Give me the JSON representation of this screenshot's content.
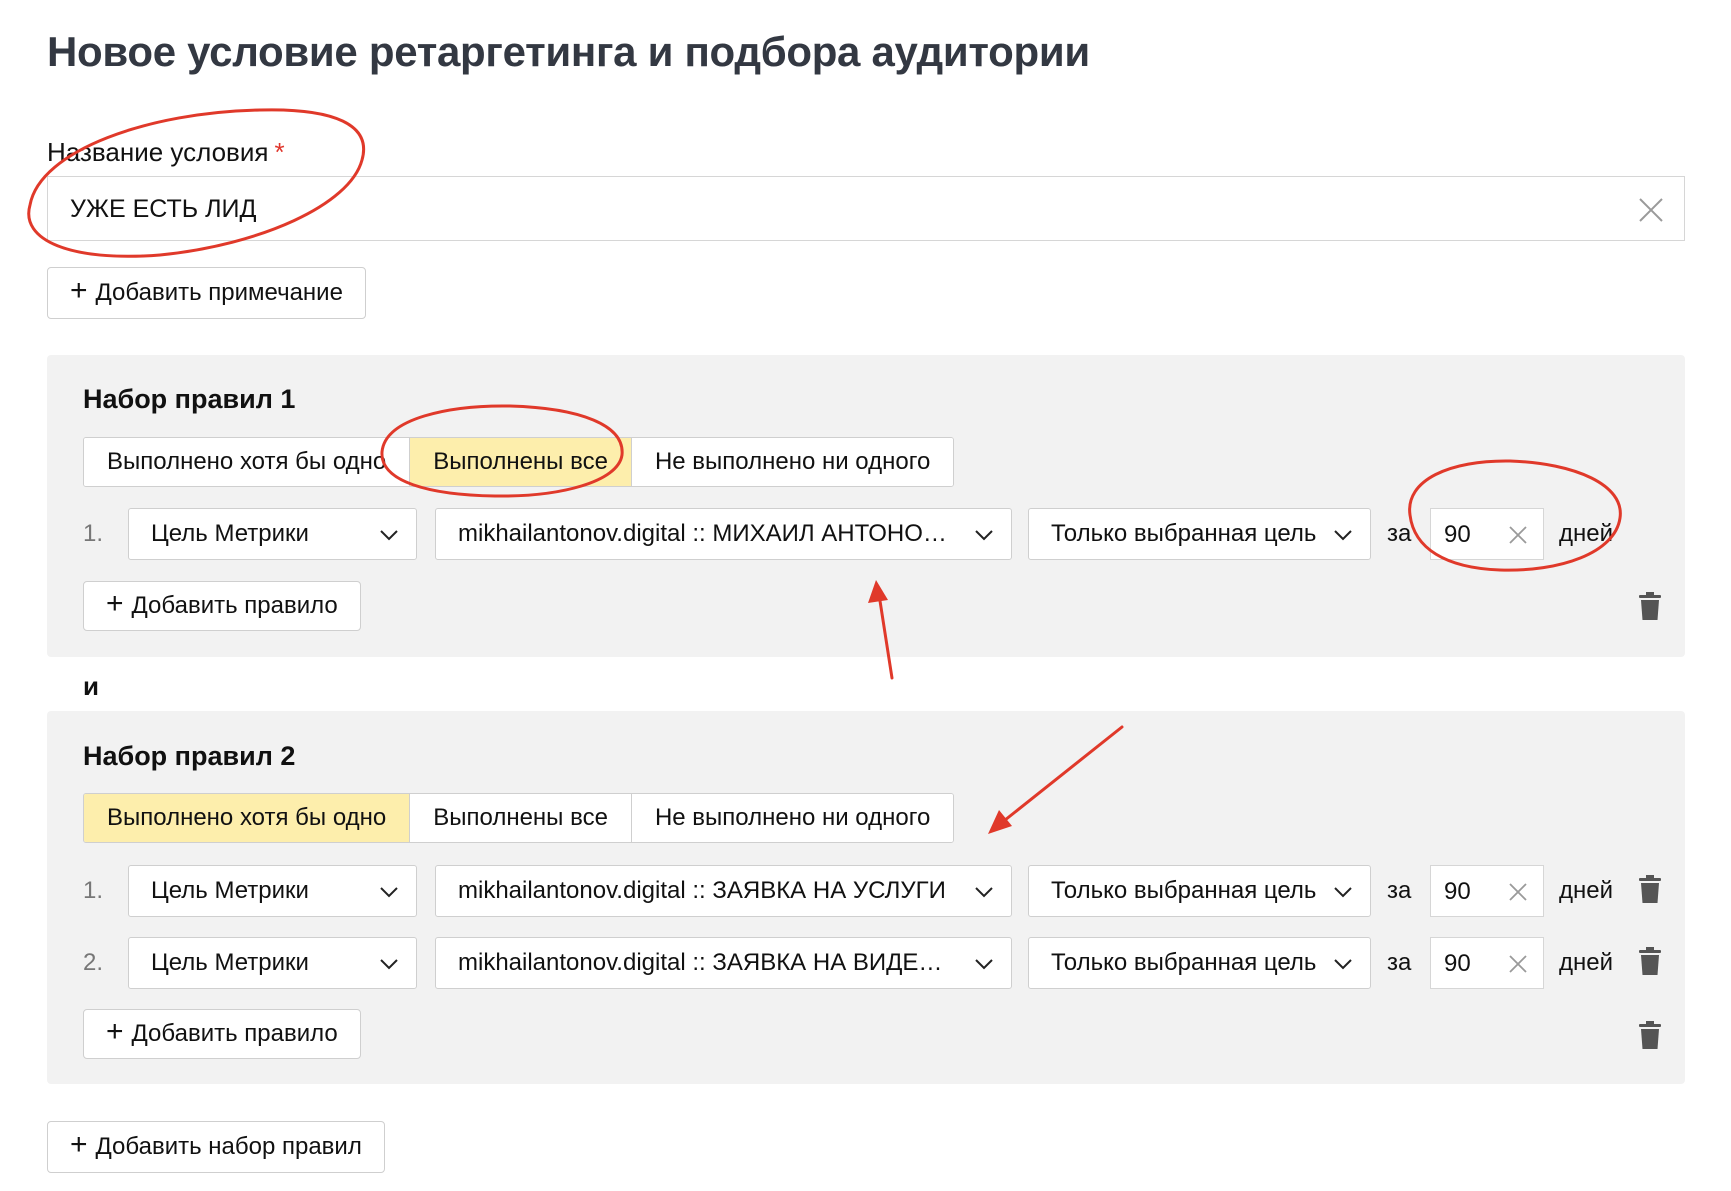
{
  "page": {
    "title": "Новое условие ретаргетинга и подбора аудитории"
  },
  "condition_name": {
    "label": "Название условия",
    "required_mark": "*",
    "value": "УЖЕ ЕСТЬ ЛИД"
  },
  "add_note_label": "Добавить примечание",
  "rulesets": [
    {
      "title": "Набор правил 1",
      "modes": [
        "Выполнено хотя бы одно",
        "Выполнены все",
        "Не выполнено ни одного"
      ],
      "active_mode": 1,
      "rules": [
        {
          "num": "1.",
          "type": "Цель Метрики",
          "goal": "mikhailantonov.digital :: МИХАИЛ АНТОНОВ :: ЗАЯВКА",
          "scope": "Только выбранная цель",
          "za": "за",
          "days": "90",
          "days_unit": "дней"
        }
      ],
      "add_rule_label": "Добавить правило"
    },
    {
      "title": "Набор правил 2",
      "modes": [
        "Выполнено хотя бы одно",
        "Выполнены все",
        "Не выполнено ни одного"
      ],
      "active_mode": 0,
      "rules": [
        {
          "num": "1.",
          "type": "Цель Метрики",
          "goal": "mikhailantonov.digital :: ЗАЯВКА НА УСЛУГИ",
          "scope": "Только выбранная цель",
          "za": "за",
          "days": "90",
          "days_unit": "дней"
        },
        {
          "num": "2.",
          "type": "Цель Метрики",
          "goal": "mikhailantonov.digital :: ЗАЯВКА НА ВИДЕОКУРС",
          "scope": "Только выбранная цель",
          "za": "за",
          "days": "90",
          "days_unit": "дней"
        }
      ],
      "add_rule_label": "Добавить правило"
    }
  ],
  "and_label": "и",
  "add_ruleset_label": "Добавить набор правил",
  "icons": {
    "plus": "+",
    "clear": "close-icon",
    "dropdown": "chevron-down-icon",
    "delete": "trash-icon"
  },
  "colors": {
    "active_segment": "#fdeeac",
    "ruleset_bg": "#f2f2f2",
    "required": "#e0352b",
    "annotation": "#e0392a"
  }
}
